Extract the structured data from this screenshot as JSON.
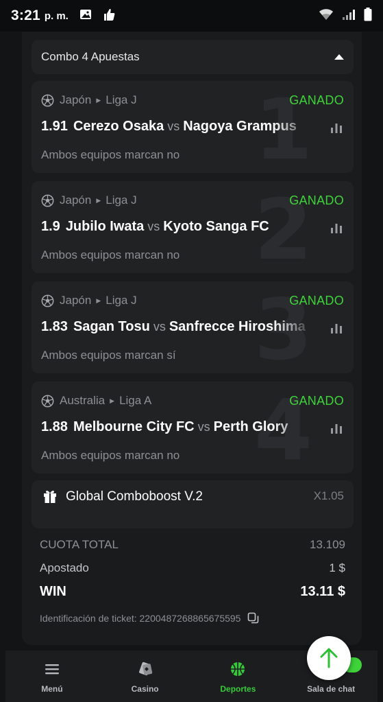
{
  "status_bar": {
    "time": "3:21",
    "ampm": "p. m."
  },
  "combo": {
    "title": "Combo 4 Apuestas"
  },
  "bets": [
    {
      "number": "1",
      "country": "Japón",
      "league": "Liga J",
      "status": "GANADO",
      "odds": "1.91",
      "home": "Cerezo Osaka",
      "vs": "vs",
      "away": "Nagoya Grampus",
      "market": "Ambos equipos marcan no"
    },
    {
      "number": "2",
      "country": "Japón",
      "league": "Liga J",
      "status": "GANADO",
      "odds": "1.9",
      "home": "Jubilo Iwata",
      "vs": "vs",
      "away": "Kyoto Sanga FC",
      "market": "Ambos equipos marcan no"
    },
    {
      "number": "3",
      "country": "Japón",
      "league": "Liga J",
      "status": "GANADO",
      "odds": "1.83",
      "home": "Sagan Tosu",
      "vs": "vs",
      "away": "Sanfrecce Hiroshima",
      "market": "Ambos equipos marcan sí"
    },
    {
      "number": "4",
      "country": "Australia",
      "league": "Liga A",
      "status": "GANADO",
      "odds": "1.88",
      "home": "Melbourne City FC",
      "vs": "vs",
      "away": "Perth Glory",
      "market": "Ambos equipos marcan no"
    }
  ],
  "boost": {
    "title": "Global Comboboost V.2",
    "value": "X1.05"
  },
  "summary": {
    "total_odds_label": "CUOTA TOTAL",
    "total_odds_value": "13.109",
    "stake_label": "Apostado",
    "stake_value": "1 $",
    "win_label": "WIN",
    "win_value": "13.11 $"
  },
  "ticket": {
    "label": "Identificación de ticket: 2200487268865675595"
  },
  "nav": [
    {
      "label": "Menú",
      "icon": "menu-icon"
    },
    {
      "label": "Casino",
      "icon": "casino-icon"
    },
    {
      "label": "Deportes",
      "icon": "sports-icon"
    },
    {
      "label": "Sala de chat",
      "icon": "chat-icon"
    }
  ],
  "colors": {
    "win_status": "#3fd33a",
    "active_nav": "#38c93a",
    "card_bg": "#212224"
  }
}
